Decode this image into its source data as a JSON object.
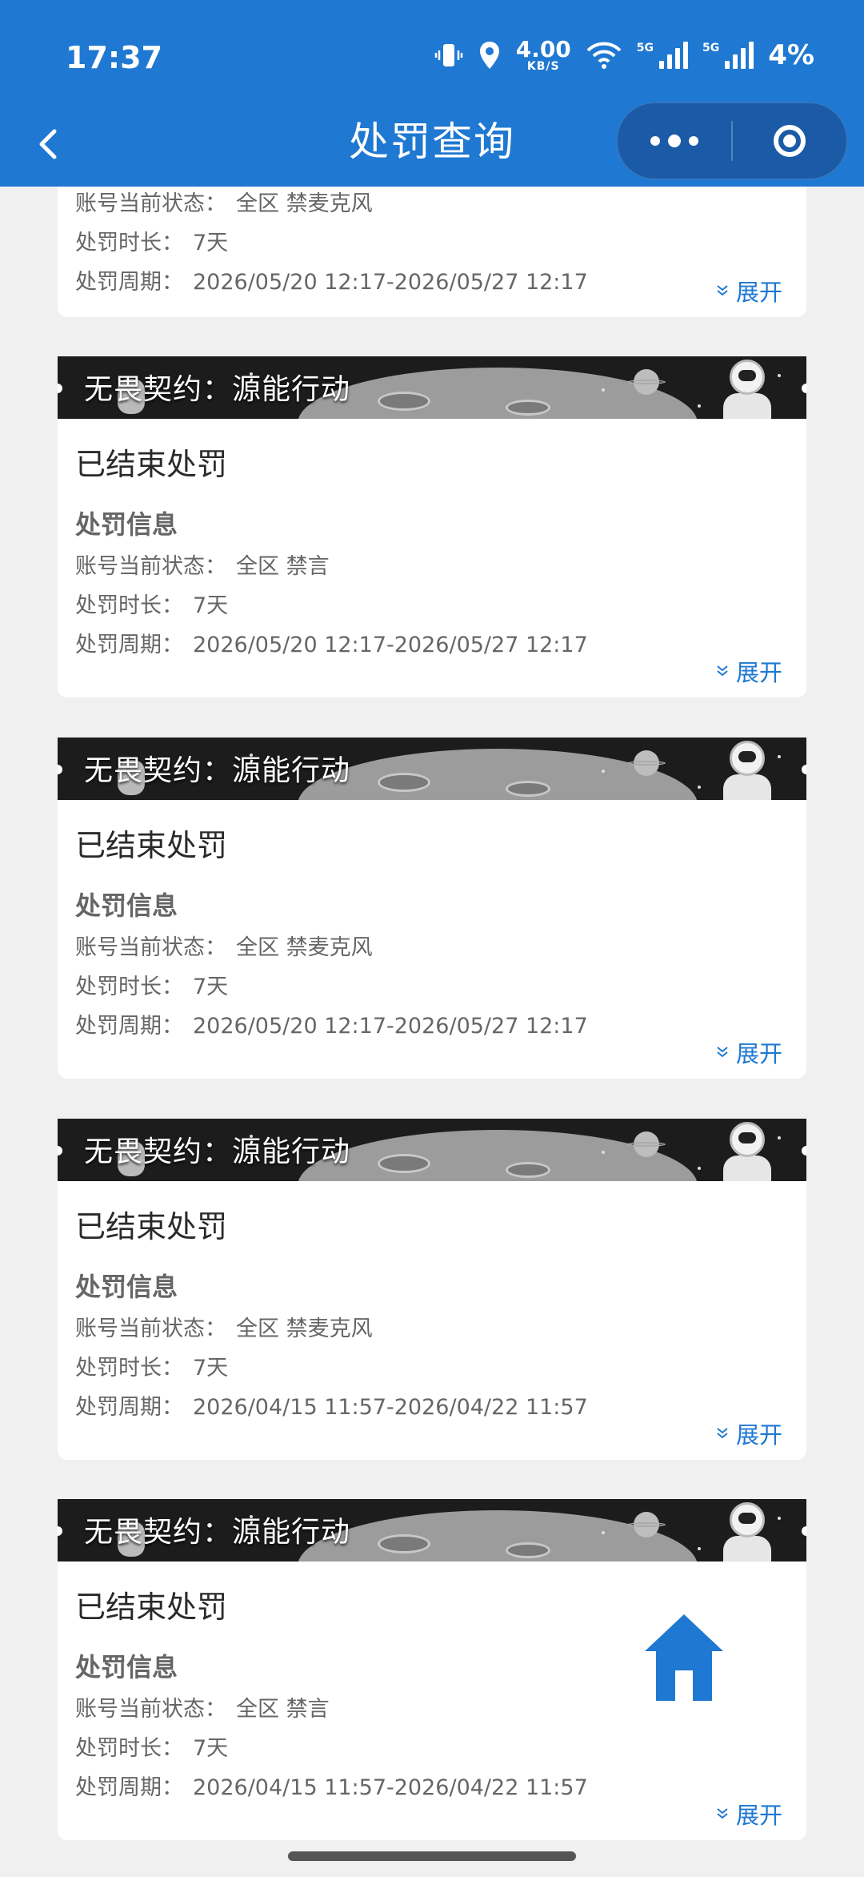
{
  "status_bar": {
    "time": "17:37",
    "speed_value": "4.00",
    "speed_unit": "KB/S",
    "net1": "5G",
    "net2": "5G",
    "battery": "4%"
  },
  "navbar": {
    "title": "处罚查询"
  },
  "labels": {
    "status": "账号当前状态：",
    "duration": "处罚时长：",
    "period": "处罚周期：",
    "section": "处罚信息",
    "expand": "展开"
  },
  "top_card": {
    "status": "全区 禁麦克风",
    "duration": "7天",
    "period": "2026/05/20 12:17-2026/05/27 12:17"
  },
  "cards": [
    {
      "game": "无畏契约：源能行动",
      "title": "已结束处罚",
      "status": "全区 禁言",
      "duration": "7天",
      "period": "2026/05/20 12:17-2026/05/27 12:17"
    },
    {
      "game": "无畏契约：源能行动",
      "title": "已结束处罚",
      "status": "全区 禁麦克风",
      "duration": "7天",
      "period": "2026/05/20 12:17-2026/05/27 12:17"
    },
    {
      "game": "无畏契约：源能行动",
      "title": "已结束处罚",
      "status": "全区 禁麦克风",
      "duration": "7天",
      "period": "2026/04/15 11:57-2026/04/22 11:57"
    },
    {
      "game": "无畏契约：源能行动",
      "title": "已结束处罚",
      "status": "全区 禁言",
      "duration": "7天",
      "period": "2026/04/15 11:57-2026/04/22 11:57"
    }
  ],
  "colors": {
    "brand": "#1f78d1",
    "background": "#f0f0f0",
    "card": "#ffffff"
  }
}
